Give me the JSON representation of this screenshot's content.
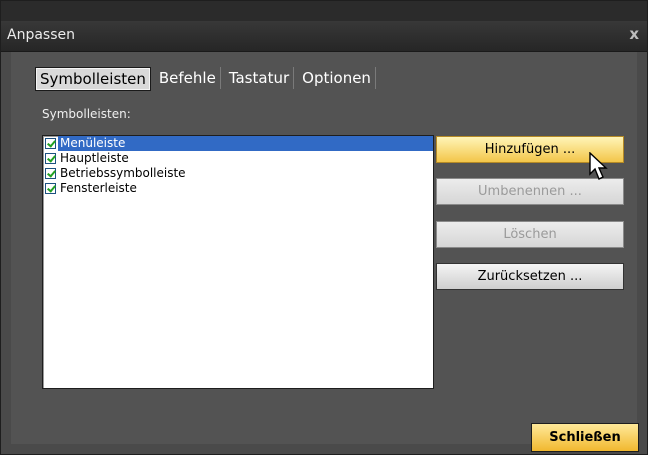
{
  "window": {
    "title": "Anpassen",
    "close_glyph": "x"
  },
  "tabs": [
    {
      "label": "Symbolleisten",
      "active": true
    },
    {
      "label": "Befehle",
      "active": false
    },
    {
      "label": "Tastatur",
      "active": false
    },
    {
      "label": "Optionen",
      "active": false
    }
  ],
  "toolbars_label": "Symbolleisten:",
  "toolbars": [
    {
      "label": "Menüleiste",
      "checked": true,
      "selected": true
    },
    {
      "label": "Hauptleiste",
      "checked": true,
      "selected": false
    },
    {
      "label": "Betriebssymbolleiste",
      "checked": true,
      "selected": false
    },
    {
      "label": "Fensterleiste",
      "checked": true,
      "selected": false
    }
  ],
  "buttons": {
    "add": "Hinzufügen ...",
    "rename": "Umbenennen ...",
    "delete": "Löschen",
    "reset": "Zurücksetzen ..."
  },
  "footer": {
    "close": "Schließen"
  },
  "icons": {
    "close": "close-icon",
    "check": "check-icon",
    "cursor": "mouse-pointer-icon"
  },
  "colors": {
    "selection": "#316ac5",
    "button_highlight": "#f3c64a",
    "background": "#4a4a4a"
  }
}
